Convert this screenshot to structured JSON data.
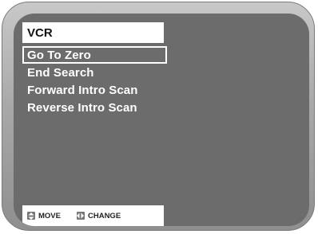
{
  "menu": {
    "title": "VCR",
    "items": [
      {
        "label": "Go To Zero",
        "selected": true
      },
      {
        "label": "End Search",
        "selected": false
      },
      {
        "label": "Forward Intro Scan",
        "selected": false
      },
      {
        "label": "Reverse Intro Scan",
        "selected": false
      }
    ]
  },
  "footer": {
    "move_icon": "up-down-arrows-icon",
    "move_label": "MOVE",
    "change_icon": "left-right-arrows-icon",
    "change_label": "CHANGE"
  },
  "colors": {
    "screen_background": "#6c6c6c",
    "bezel": "#a9a9a9",
    "text_on_screen": "#ffffff",
    "panel_background": "#ffffff"
  }
}
